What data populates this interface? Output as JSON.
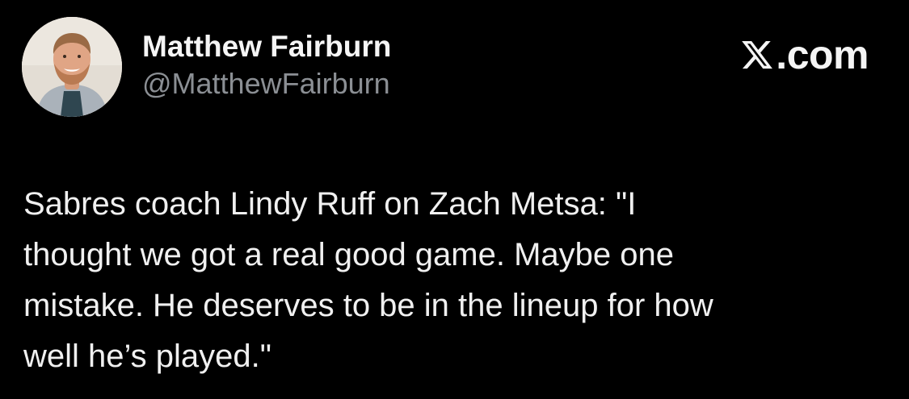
{
  "author": {
    "display_name": "Matthew Fairburn",
    "handle": "@MatthewFairburn"
  },
  "brand": {
    "logo_icon": "x-logo-icon",
    "label": ".com"
  },
  "tweet": {
    "text": "Sabres coach Lindy Ruff on Zach Metsa: \"I\nthought we got a real good game. Maybe one\nmistake. He deserves to be in the lineup for how\nwell he’s played.\""
  },
  "colors": {
    "background": "#000000",
    "name": "#f5f5f5",
    "handle": "#8b8f94",
    "text": "#f0f0f0"
  }
}
